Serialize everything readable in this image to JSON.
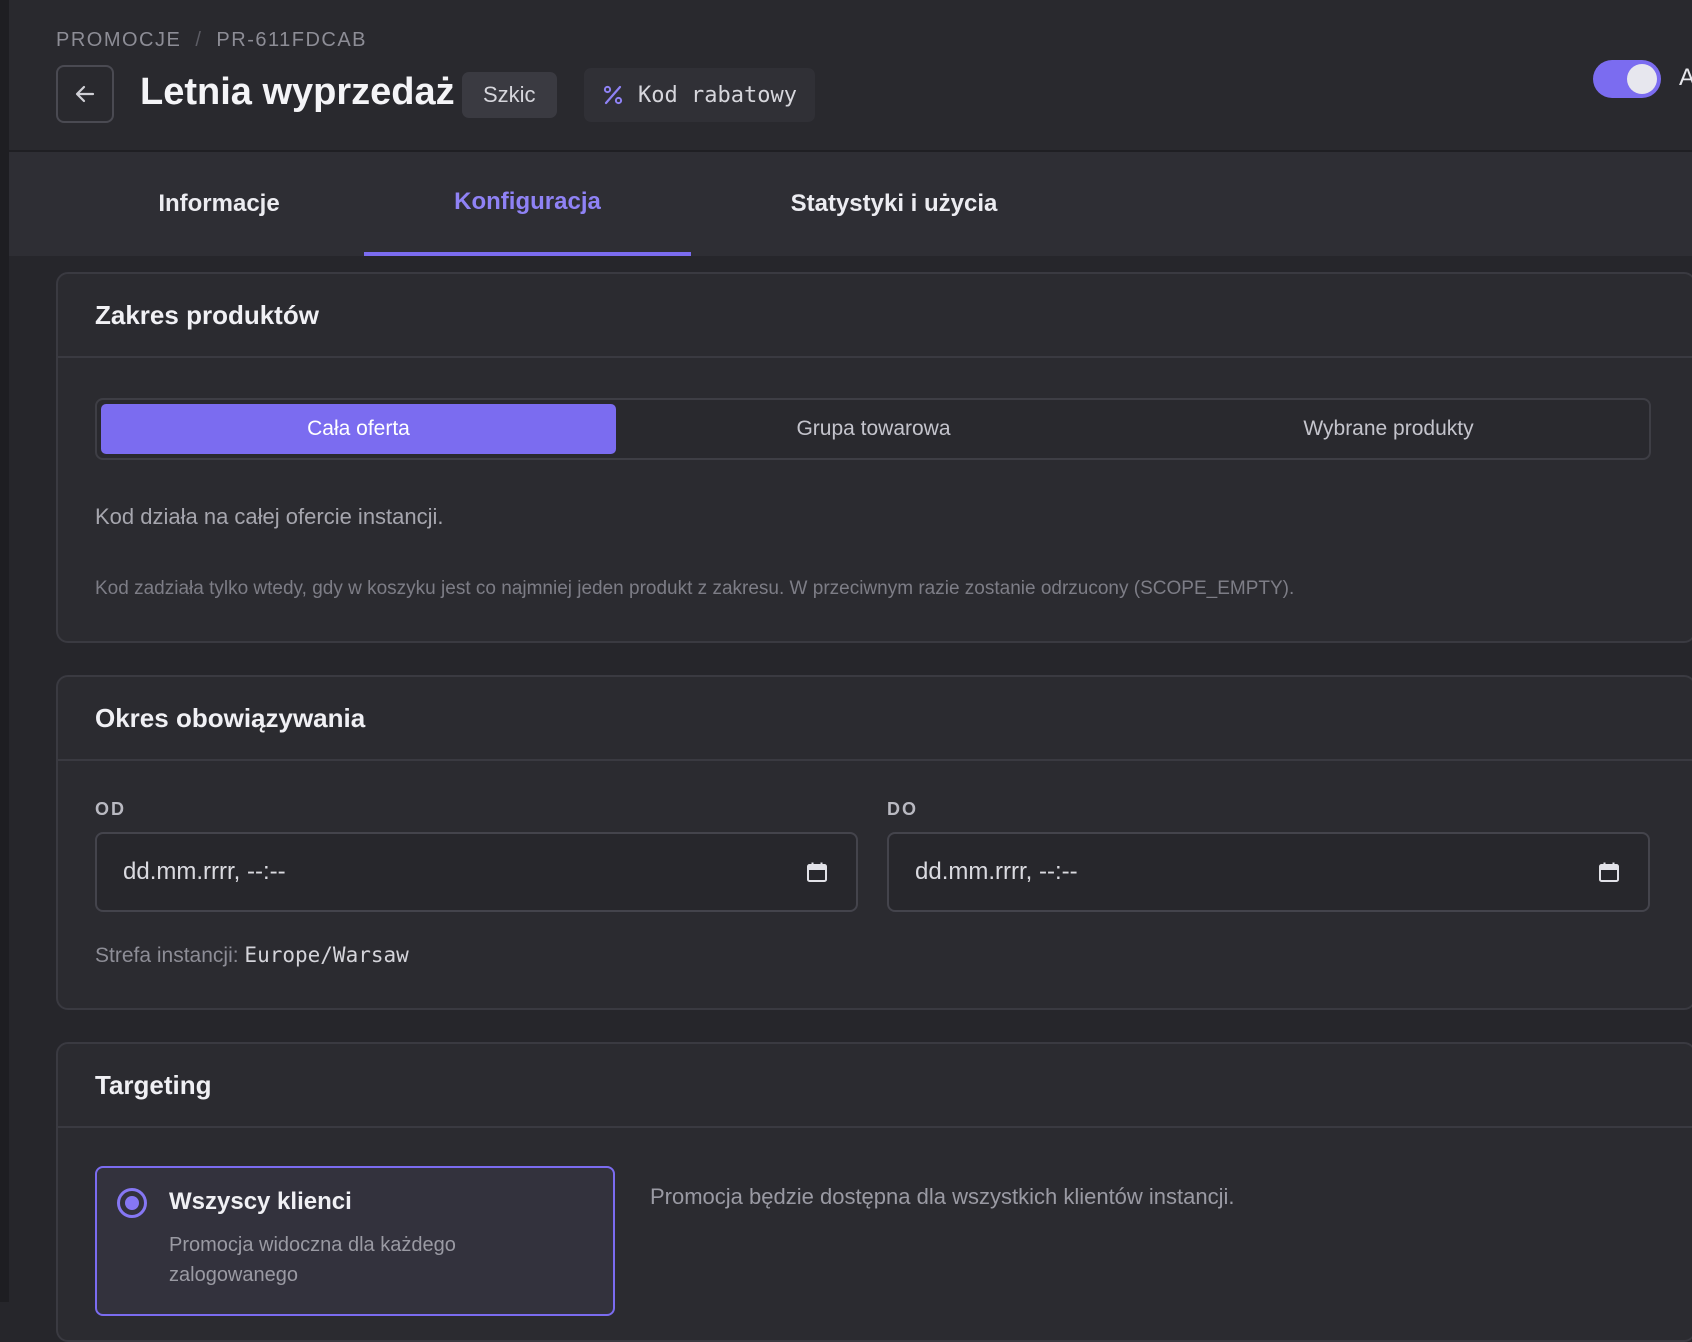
{
  "breadcrumb": {
    "section": "PROMOCJE",
    "separator": "/",
    "id": "PR-611FDCAB"
  },
  "header": {
    "title": "Letnia wyprzedaż",
    "status": "Szkic",
    "type_label": "Kod rabatowy",
    "toggle_label": "Au",
    "toggle_on": true
  },
  "tabs": [
    {
      "label": "Informacje",
      "active": false
    },
    {
      "label": "Konfiguracja",
      "active": true
    },
    {
      "label": "Statystyki i użycia",
      "active": false
    }
  ],
  "scope": {
    "title": "Zakres produktów",
    "options": [
      "Cała oferta",
      "Grupa towarowa",
      "Wybrane produkty"
    ],
    "selected": "Cała oferta",
    "description": "Kod działa na całej ofercie instancji.",
    "note": "Kod zadziała tylko wtedy, gdy w koszyku jest co najmniej jeden produkt z zakresu. W przeciwnym razie zostanie odrzucony (SCOPE_EMPTY)."
  },
  "validity": {
    "title": "Okres obowiązywania",
    "from_label": "OD",
    "from_value": "dd.mm.rrrr, --:--",
    "to_label": "DO",
    "to_value": "dd.mm.rrrr, --:--",
    "timezone_label": "Strefa instancji:",
    "timezone": "Europe/Warsaw"
  },
  "targeting": {
    "title": "Targeting",
    "option_title": "Wszyscy klienci",
    "option_desc": "Promocja widoczna dla każdego zalogowanego",
    "selected": true,
    "info": "Promocja będzie dostępna dla wszystkich klientów instancji."
  },
  "colors": {
    "accent": "#7b6cf0",
    "background": "#26262b",
    "card": "#2b2b30"
  },
  "icons": [
    "arrow-left-icon",
    "percent-icon",
    "calendar-icon",
    "radio-checked-icon"
  ]
}
